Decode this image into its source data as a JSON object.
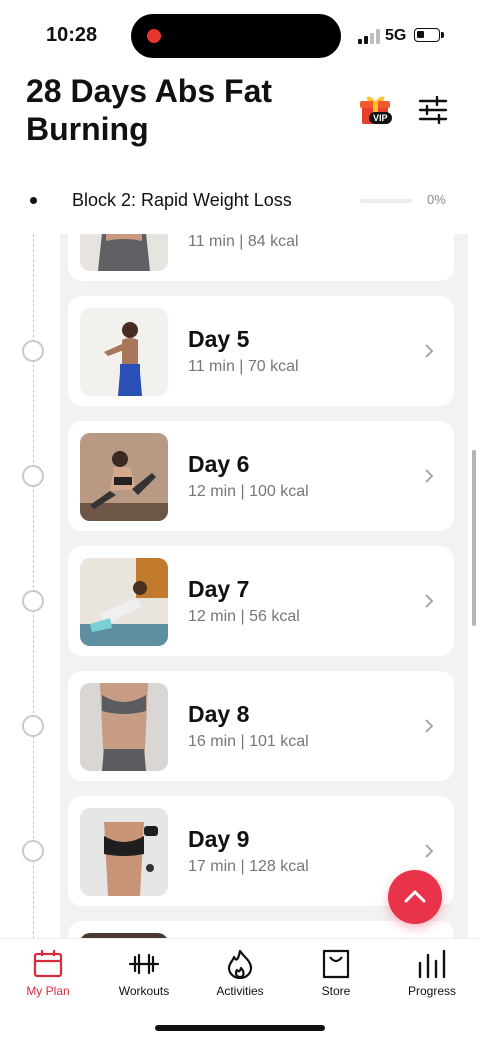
{
  "status_bar": {
    "time": "10:28",
    "network": "5G"
  },
  "header": {
    "title": "28 Days Abs Fat Burning",
    "vip_badge": "VIP"
  },
  "block": {
    "title": "Block 2: Rapid Weight Loss",
    "progress_percent": 0,
    "progress_label": "0%"
  },
  "days": [
    {
      "title": "",
      "meta": "11 min | 84 kcal"
    },
    {
      "title": "Day 5",
      "meta": "11 min | 70 kcal"
    },
    {
      "title": "Day 6",
      "meta": "12 min | 100 kcal"
    },
    {
      "title": "Day 7",
      "meta": "12 min | 56 kcal"
    },
    {
      "title": "Day 8",
      "meta": "16 min | 101 kcal"
    },
    {
      "title": "Day 9",
      "meta": "17 min | 128 kcal"
    }
  ],
  "nav": {
    "my_plan": "My Plan",
    "workouts": "Workouts",
    "activities": "Activities",
    "store": "Store",
    "progress": "Progress"
  },
  "colors": {
    "accent": "#e8334a",
    "active_nav": "#d82c3f"
  },
  "icons": {
    "vip": "gift-icon",
    "filter": "sliders-icon",
    "fab": "chevron-up-icon",
    "nav": [
      "calendar-icon",
      "dumbbell-icon",
      "flame-icon",
      "shopping-bag-icon",
      "bar-chart-icon"
    ]
  }
}
